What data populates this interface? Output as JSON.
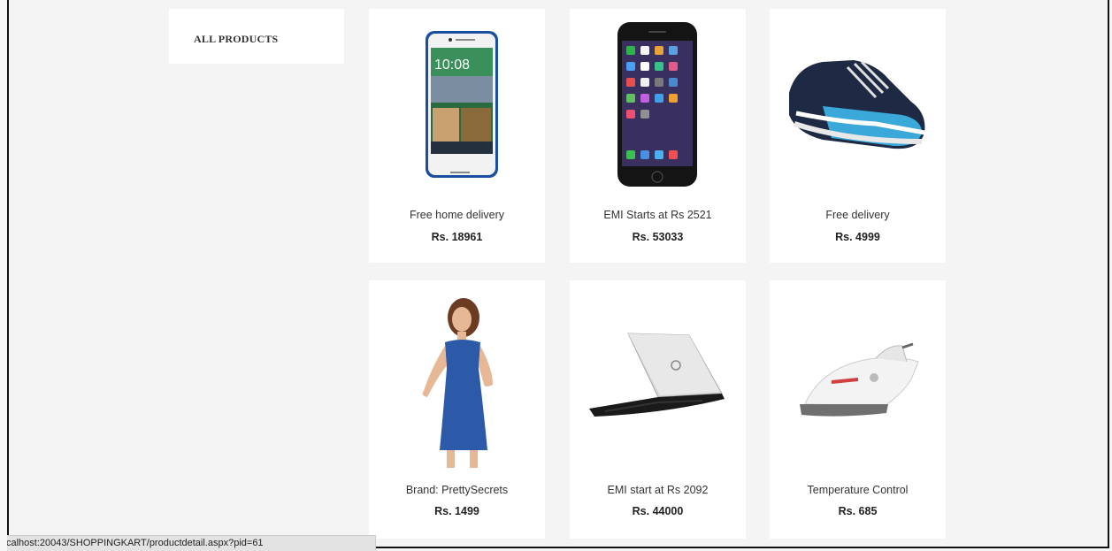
{
  "sidebar": {
    "title": "ALL PRODUCTS"
  },
  "products": [
    {
      "image": "smartphone-htc",
      "description": "Free home delivery",
      "price": "Rs. 18961"
    },
    {
      "image": "smartphone-iphone",
      "description": "EMI Starts at Rs 2521",
      "price": "Rs. 53033"
    },
    {
      "image": "sneaker-shoe",
      "description": "Free delivery",
      "price": "Rs. 4999"
    },
    {
      "image": "blue-dress",
      "description": "Brand: PrettySecrets",
      "price": "Rs. 1499"
    },
    {
      "image": "laptop-dell",
      "description": "EMI start at Rs 2092",
      "price": "Rs. 44000"
    },
    {
      "image": "steam-iron",
      "description": "Temperature Control",
      "price": "Rs. 685"
    }
  ],
  "status_bar": {
    "url": "calhost:20043/SHOPPINGKART/productdetail.aspx?pid=61"
  }
}
